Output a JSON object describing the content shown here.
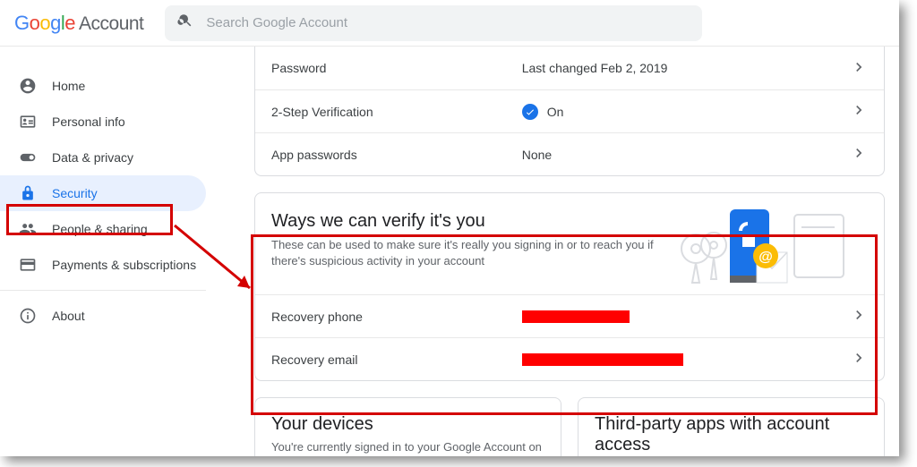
{
  "header": {
    "brand_word": "Google",
    "brand_sub": "Account",
    "search_placeholder": "Search Google Account"
  },
  "sidebar": {
    "items": [
      {
        "label": "Home"
      },
      {
        "label": "Personal info"
      },
      {
        "label": "Data & privacy"
      },
      {
        "label": "Security"
      },
      {
        "label": "People & sharing"
      },
      {
        "label": "Payments & subscriptions"
      }
    ],
    "about_label": "About"
  },
  "signin_card": {
    "rows": [
      {
        "label": "Password",
        "value": "Last changed Feb 2, 2019",
        "check": false
      },
      {
        "label": "2-Step Verification",
        "value": "On",
        "check": true
      },
      {
        "label": "App passwords",
        "value": "None",
        "check": false
      }
    ]
  },
  "verify_card": {
    "title": "Ways we can verify it's you",
    "desc": "These can be used to make sure it's really you signing in or to reach you if there's suspicious activity in your account",
    "rows": [
      {
        "label": "Recovery phone",
        "redact_width": 120
      },
      {
        "label": "Recovery email",
        "redact_width": 180
      }
    ]
  },
  "bottom": {
    "devices_title": "Your devices",
    "devices_desc": "You're currently signed in to your Google Account on",
    "thirdparty_title": "Third-party apps with account access"
  }
}
